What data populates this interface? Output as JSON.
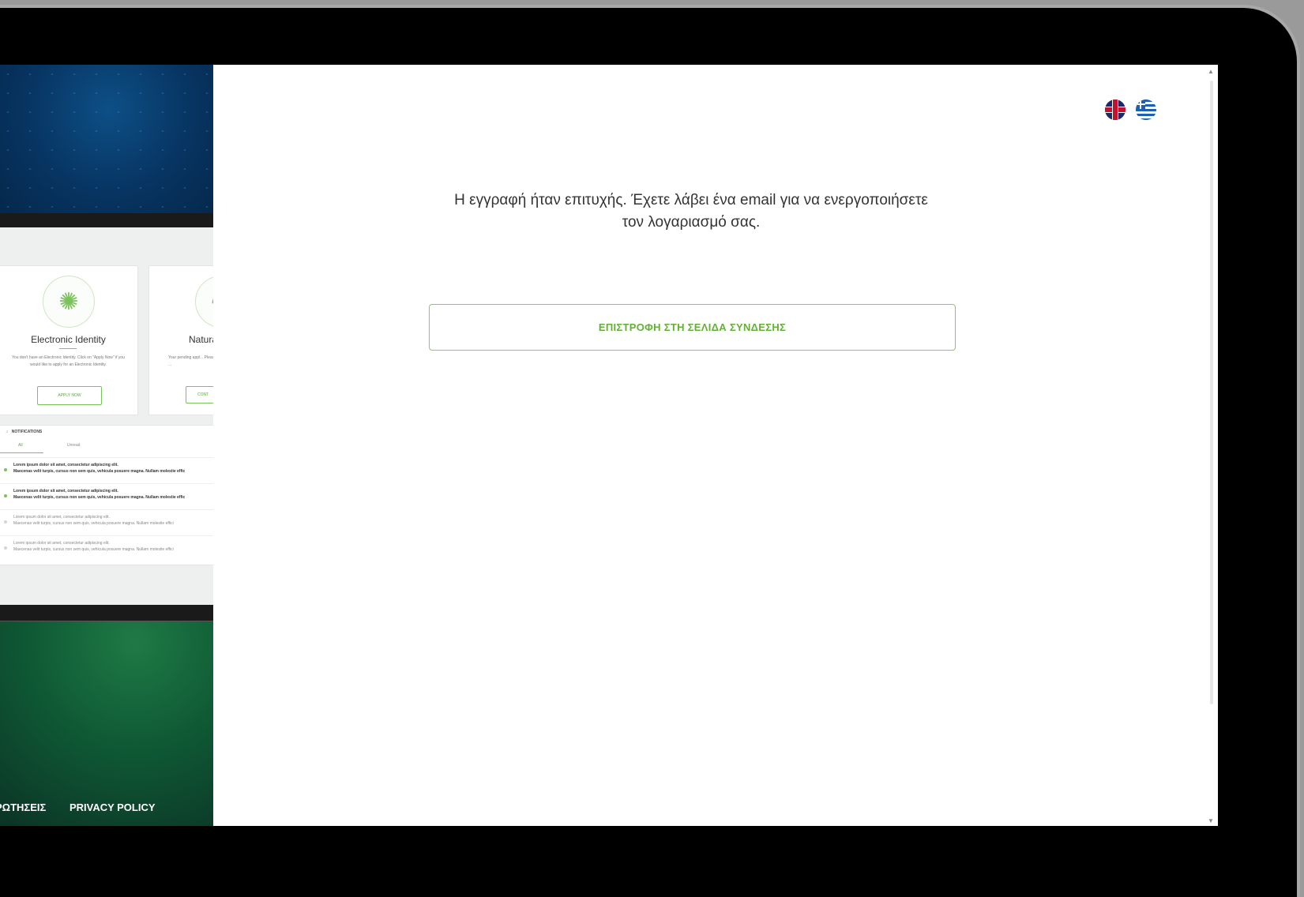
{
  "showcase": {
    "cards": [
      {
        "title": "Electronic Identity",
        "description": "You don't have an Electronic Identity. Click on \"Apply Now\" if you would like to apply for an Electronic Identity.",
        "button": "APPLY NOW"
      },
      {
        "title": "Natura",
        "description": "Your pending appl... Please contact ...",
        "button": "CONT"
      }
    ],
    "notifications": {
      "heading": "NOTIFICATIONS",
      "tabs": [
        "All",
        "Unread"
      ],
      "items": [
        {
          "line1": "Lorem ipsum dolor sit amet, consectetur adipiscing elit.",
          "line2": "Maecenas velit turpis, cursus non sem quis, vehicula posuere magna. Nullam molestie effic"
        },
        {
          "line1": "Lorem ipsum dolor sit amet, consectetur adipiscing elit.",
          "line2": "Maecenas velit turpis, cursus non sem quis, vehicula posuere magna. Nullam molestie effic"
        },
        {
          "line1": "Lorem ipsum dolor sit amet, consectetur adipiscing elit.",
          "line2": "Maecenas velit turpis, cursus non sem quis, vehicula posuere magna. Nullam molestie effici"
        },
        {
          "line1": "Lorem ipsum dolor sit amet, consectetur adipiscing elit.",
          "line2": "Maecenas velit turpis, cursus non sem quis, vehicula posuere magna. Nullam molestie effici"
        }
      ]
    },
    "footer_links": [
      "ΡΩΤΗΣΕΙΣ",
      "PRIVACY POLICY"
    ]
  },
  "main": {
    "languages": [
      {
        "name": "english-flag-icon"
      },
      {
        "name": "greek-flag-icon"
      }
    ],
    "message_line1": "Η εγγραφή ήταν επιτυχής. Έχετε λάβει ένα email για να ενεργοποιήσετε",
    "message_line2": "τον λογαριασμό σας.",
    "return_button": "ΕΠΙΣΤΡΟΦΗ ΣΤΗ ΣΕΛΙΔΑ ΣΥΝΔΕΣΗΣ"
  },
  "colors": {
    "accent": "#63b037",
    "button_border": "#8cc866",
    "text": "#333333"
  }
}
